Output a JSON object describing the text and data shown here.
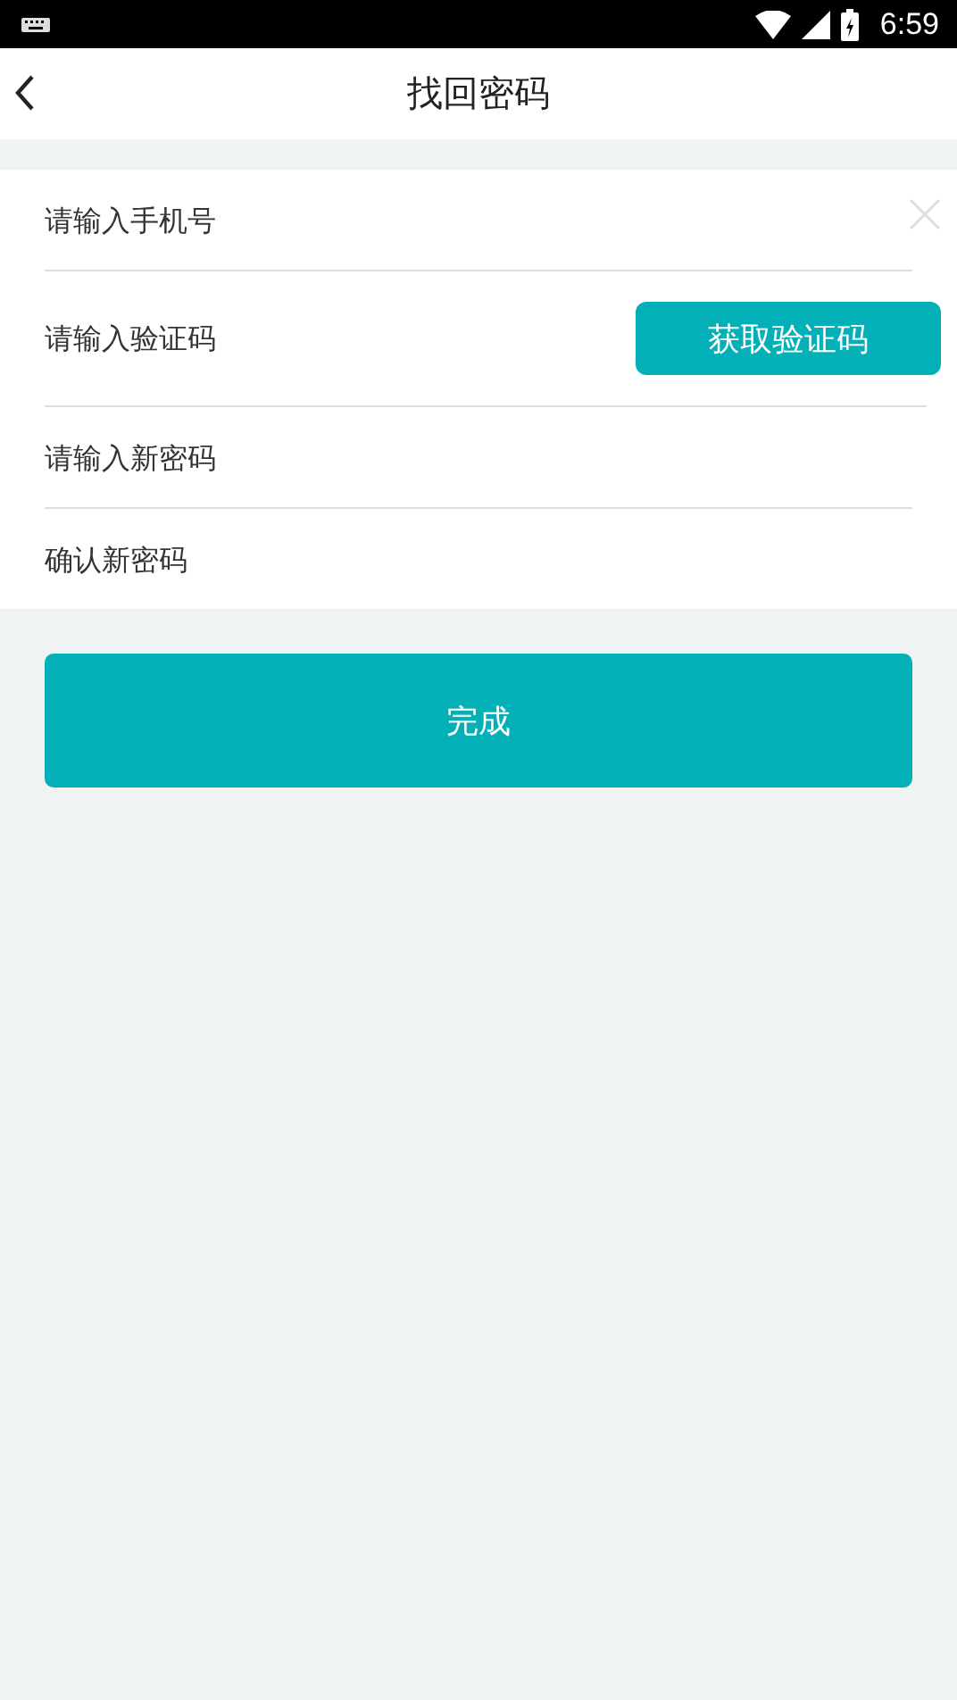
{
  "status_bar": {
    "time": "6:59"
  },
  "header": {
    "title": "找回密码"
  },
  "fields": [
    {
      "kind": "clear",
      "placeholder": "请输入手机号"
    },
    {
      "kind": "code",
      "placeholder": "请输入验证码",
      "button": "获取验证码"
    },
    {
      "kind": "plain",
      "placeholder": "请输入新密码"
    },
    {
      "kind": "plain",
      "placeholder": "确认新密码"
    }
  ],
  "submit": "完成"
}
